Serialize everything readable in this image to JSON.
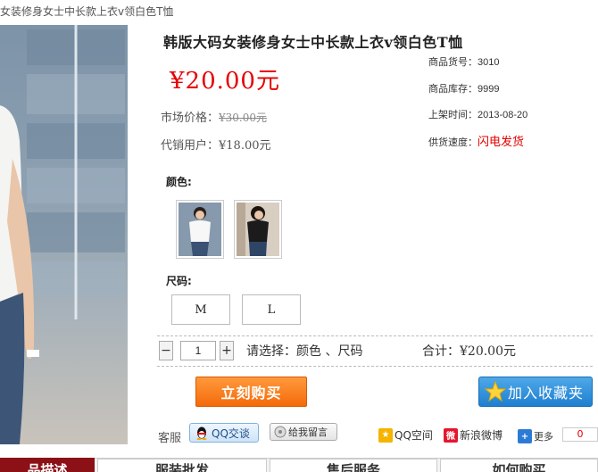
{
  "breadcrumb": "女装修身女士中长款上衣v领白色T恤",
  "product": {
    "title": "韩版大码女装修身女士中长款上衣v领白色T恤",
    "price": "¥20.00元",
    "market_price_label": "市场价格：",
    "market_price_value": "¥30.00元",
    "agent_label": "代销用户：",
    "agent_value": "¥18.00元"
  },
  "info": {
    "sku_label": "商品货号：",
    "sku_value": "3010",
    "stock_label": "商品库存：",
    "stock_value": "9999",
    "date_label": "上架时间：",
    "date_value": "2013-08-20",
    "speed_label": "供货速度：",
    "speed_value": "闪电发货"
  },
  "options": {
    "color_title": "颜色:",
    "size_title": "尺码:",
    "sizes": [
      "M",
      "L"
    ]
  },
  "purchase": {
    "quantity": "1",
    "minus": "−",
    "plus": "+",
    "select_prompt": "请选择：颜色 、尺码",
    "total_label": "合计：",
    "total_value": "¥20.00元",
    "buy_label": "立刻购买",
    "fav_label": "加入收藏夹"
  },
  "service": {
    "label": "客服",
    "qq_label": "QQ交谈",
    "msg_label": "给我留言"
  },
  "share": {
    "qzone": "QQ空间",
    "weibo": "新浪微博",
    "more": "更多",
    "count": "0"
  },
  "tabs": [
    "品描述",
    "服装批发",
    "售后服务",
    "如何购买"
  ],
  "colors": {
    "price_red": "#e60000",
    "buy_orange": "#f46a0a",
    "fav_blue": "#1f7fd0",
    "tab_active": "#8b1117"
  }
}
